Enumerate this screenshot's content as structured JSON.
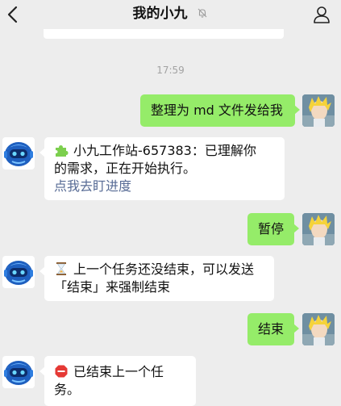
{
  "header": {
    "title": "我的小九",
    "icons": {
      "back": "chevron-left-icon",
      "mute": "bell-off-icon",
      "profile": "person-icon"
    }
  },
  "timestamp": "17:59",
  "colors": {
    "background": "#ededed",
    "outgoing_bubble": "#95ec69",
    "incoming_bubble": "#ffffff",
    "link": "#576b95"
  },
  "messages": [
    {
      "from": "me",
      "text": "整理为 md 文件发给我"
    },
    {
      "from": "bot",
      "icon": "puzzle-piece-icon",
      "line1": "小九工作站-657383：已理解你",
      "line2": "的需求，正在开始执行。",
      "link": "点我去盯进度"
    },
    {
      "from": "me",
      "text": "暂停"
    },
    {
      "from": "bot",
      "icon": "hourglass-icon",
      "line1": "上一个任务还没结束，可以发送",
      "line2": "「结束」来强制结束"
    },
    {
      "from": "me",
      "text": "结束"
    },
    {
      "from": "bot",
      "icon": "stop-sign-icon",
      "line1": "已结束上一个任务。"
    }
  ]
}
